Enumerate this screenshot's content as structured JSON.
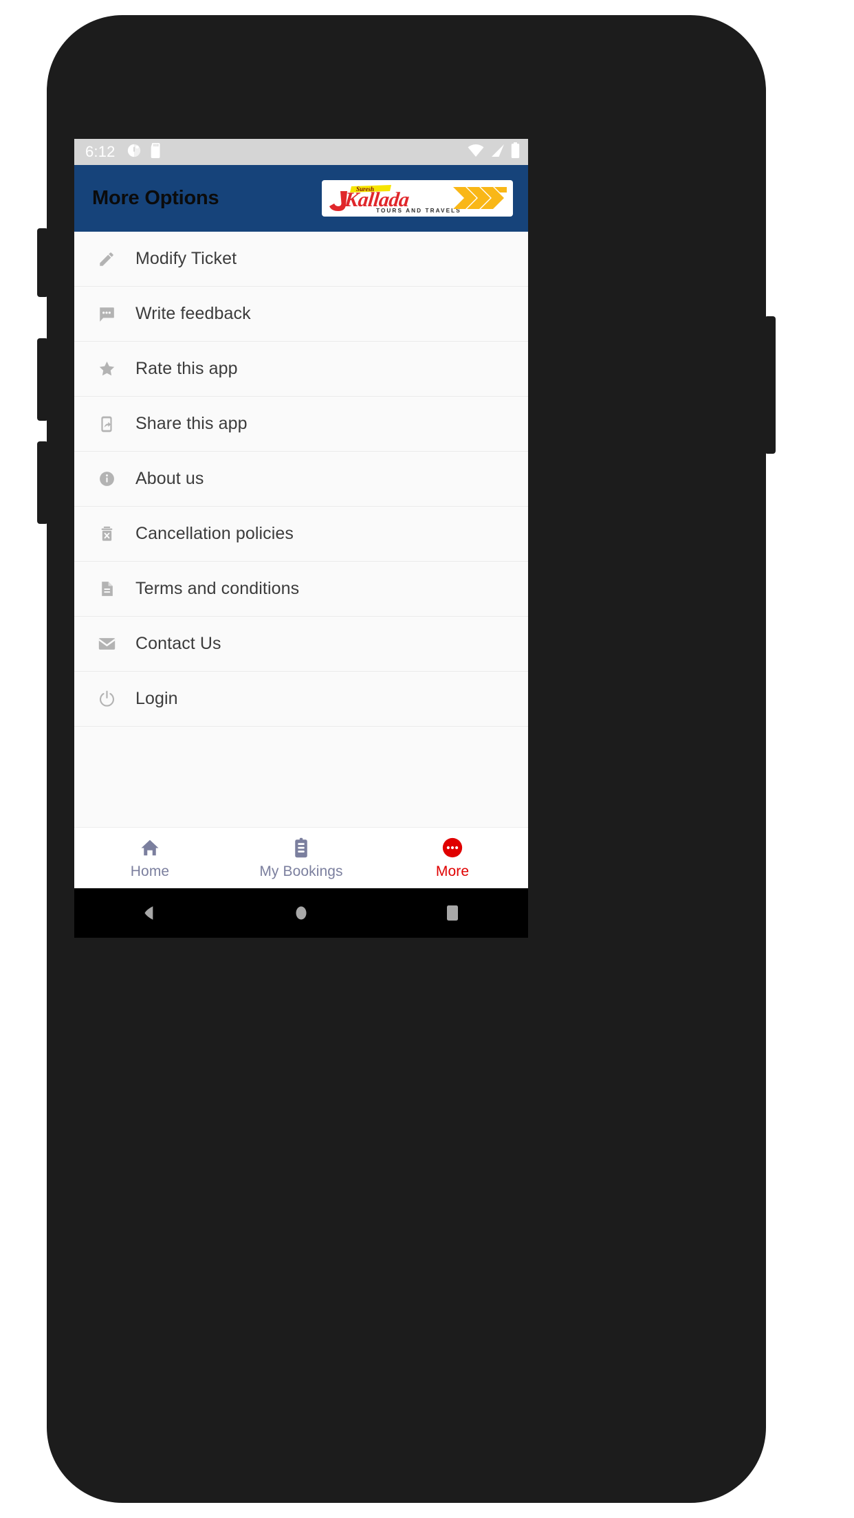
{
  "status_bar": {
    "time": "6:12",
    "left_icons": [
      "alarm-icon",
      "sd-card-icon"
    ],
    "right_icons": [
      "wifi-icon",
      "cellular-signal-icon",
      "battery-icon"
    ],
    "background_color": "#d5d5d5"
  },
  "app_bar": {
    "title": "More Options",
    "background_color": "#16437a",
    "logo": {
      "brand": "Kallada",
      "prefix": "J",
      "banner_text": "Suresh",
      "tagline": "TOURS AND TRAVELS",
      "mark": "kk-chevron-mark",
      "red": "#e0272b",
      "yellow": "#f9b717"
    }
  },
  "menu": {
    "items": [
      {
        "label": "Modify Ticket",
        "icon": "pencil-icon"
      },
      {
        "label": "Write feedback",
        "icon": "chat-bubble-icon"
      },
      {
        "label": "Rate this app",
        "icon": "star-icon"
      },
      {
        "label": "Share this app",
        "icon": "phone-share-icon"
      },
      {
        "label": "About us",
        "icon": "info-circle-icon"
      },
      {
        "label": "Cancellation policies",
        "icon": "trash-x-icon"
      },
      {
        "label": "Terms and conditions",
        "icon": "document-icon"
      },
      {
        "label": "Contact Us",
        "icon": "envelope-icon"
      },
      {
        "label": "Login",
        "icon": "power-icon"
      }
    ],
    "icon_color": "#b3b3b3",
    "text_color": "#3c3c3c"
  },
  "bottom_nav": {
    "active_color": "#e00000",
    "inactive_color": "#7b7f9e",
    "tabs": [
      {
        "label": "Home",
        "icon": "home-icon",
        "active": false
      },
      {
        "label": "My Bookings",
        "icon": "clipboard-icon",
        "active": false
      },
      {
        "label": "More",
        "icon": "more-dots-icon",
        "active": true
      }
    ]
  },
  "android_nav": {
    "buttons": [
      "back-icon",
      "home-icon",
      "recents-icon"
    ],
    "icon_color": "#a8a8a8"
  }
}
